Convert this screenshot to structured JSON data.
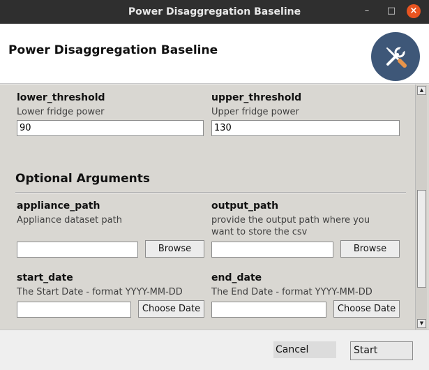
{
  "window": {
    "title": "Power Disaggregation Baseline",
    "controls": {
      "minimize": "–",
      "maximize": "□",
      "close": "×"
    }
  },
  "header": {
    "title": "Power Disaggregation Baseline",
    "badge_icon": "tools-icon",
    "badge_color": "#3e5778"
  },
  "fields": {
    "lower_threshold": {
      "name": "lower_threshold",
      "description": "Lower fridge power",
      "value": "90"
    },
    "upper_threshold": {
      "name": "upper_threshold",
      "description": "Upper fridge power",
      "value": "130"
    },
    "appliance_path": {
      "name": "appliance_path",
      "description": "Appliance dataset path",
      "value": "",
      "button": "Browse"
    },
    "output_path": {
      "name": "output_path",
      "description_line1": "provide the output path where you",
      "description_line2": "want to store the csv",
      "value": "",
      "button": "Browse"
    },
    "start_date": {
      "name": "start_date",
      "description": "The Start Date - format YYYY-MM-DD",
      "value": "",
      "button": "Choose Date"
    },
    "end_date": {
      "name": "end_date",
      "description": "The End Date - format YYYY-MM-DD",
      "value": "",
      "button": "Choose Date"
    }
  },
  "section": {
    "optional_title": "Optional Arguments"
  },
  "scrollbar": {
    "up_icon": "▲",
    "down_icon": "▼"
  },
  "footer": {
    "cancel_label": "Cancel",
    "start_label": "Start"
  }
}
